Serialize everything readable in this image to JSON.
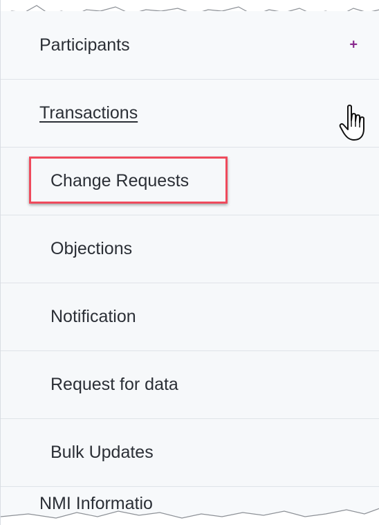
{
  "menu": {
    "participants": {
      "label": "Participants",
      "expand_icon": "plus-icon"
    },
    "transactions": {
      "label": "Transactions",
      "cursor_icon": "hand-pointer-icon"
    },
    "sub_items": [
      {
        "label": "Change Requests",
        "highlighted": true
      },
      {
        "label": "Objections"
      },
      {
        "label": "Notification"
      },
      {
        "label": "Request for data"
      },
      {
        "label": "Bulk Updates"
      }
    ],
    "nmi_information": {
      "label": "NMI Informatio"
    }
  },
  "colors": {
    "highlight_border": "#ef4a5c",
    "plus_icon": "#8a2b8f",
    "divider": "#dfe3e8"
  }
}
